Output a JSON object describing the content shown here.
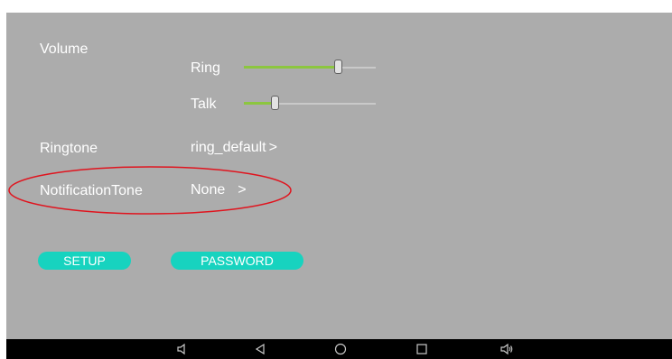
{
  "volume": {
    "title": "Volume",
    "ring": {
      "label": "Ring",
      "level": 0.72
    },
    "talk": {
      "label": "Talk",
      "level": 0.24
    }
  },
  "ringtone": {
    "label": "Ringtone",
    "value": "ring_default",
    "chevron": ">"
  },
  "notification_tone": {
    "label": "NotificationTone",
    "value": "None",
    "chevron": ">"
  },
  "buttons": {
    "setup": "SETUP",
    "password": "PASSWORD"
  },
  "colors": {
    "background": "#acacac",
    "slider_fill": "#8cc63f",
    "button": "#17d3bf",
    "highlight_ellipse": "#e0141e",
    "navbar": "#000000"
  },
  "navbar_icons": [
    "volume-down-icon",
    "back-icon",
    "home-icon",
    "recents-icon",
    "volume-up-icon"
  ]
}
